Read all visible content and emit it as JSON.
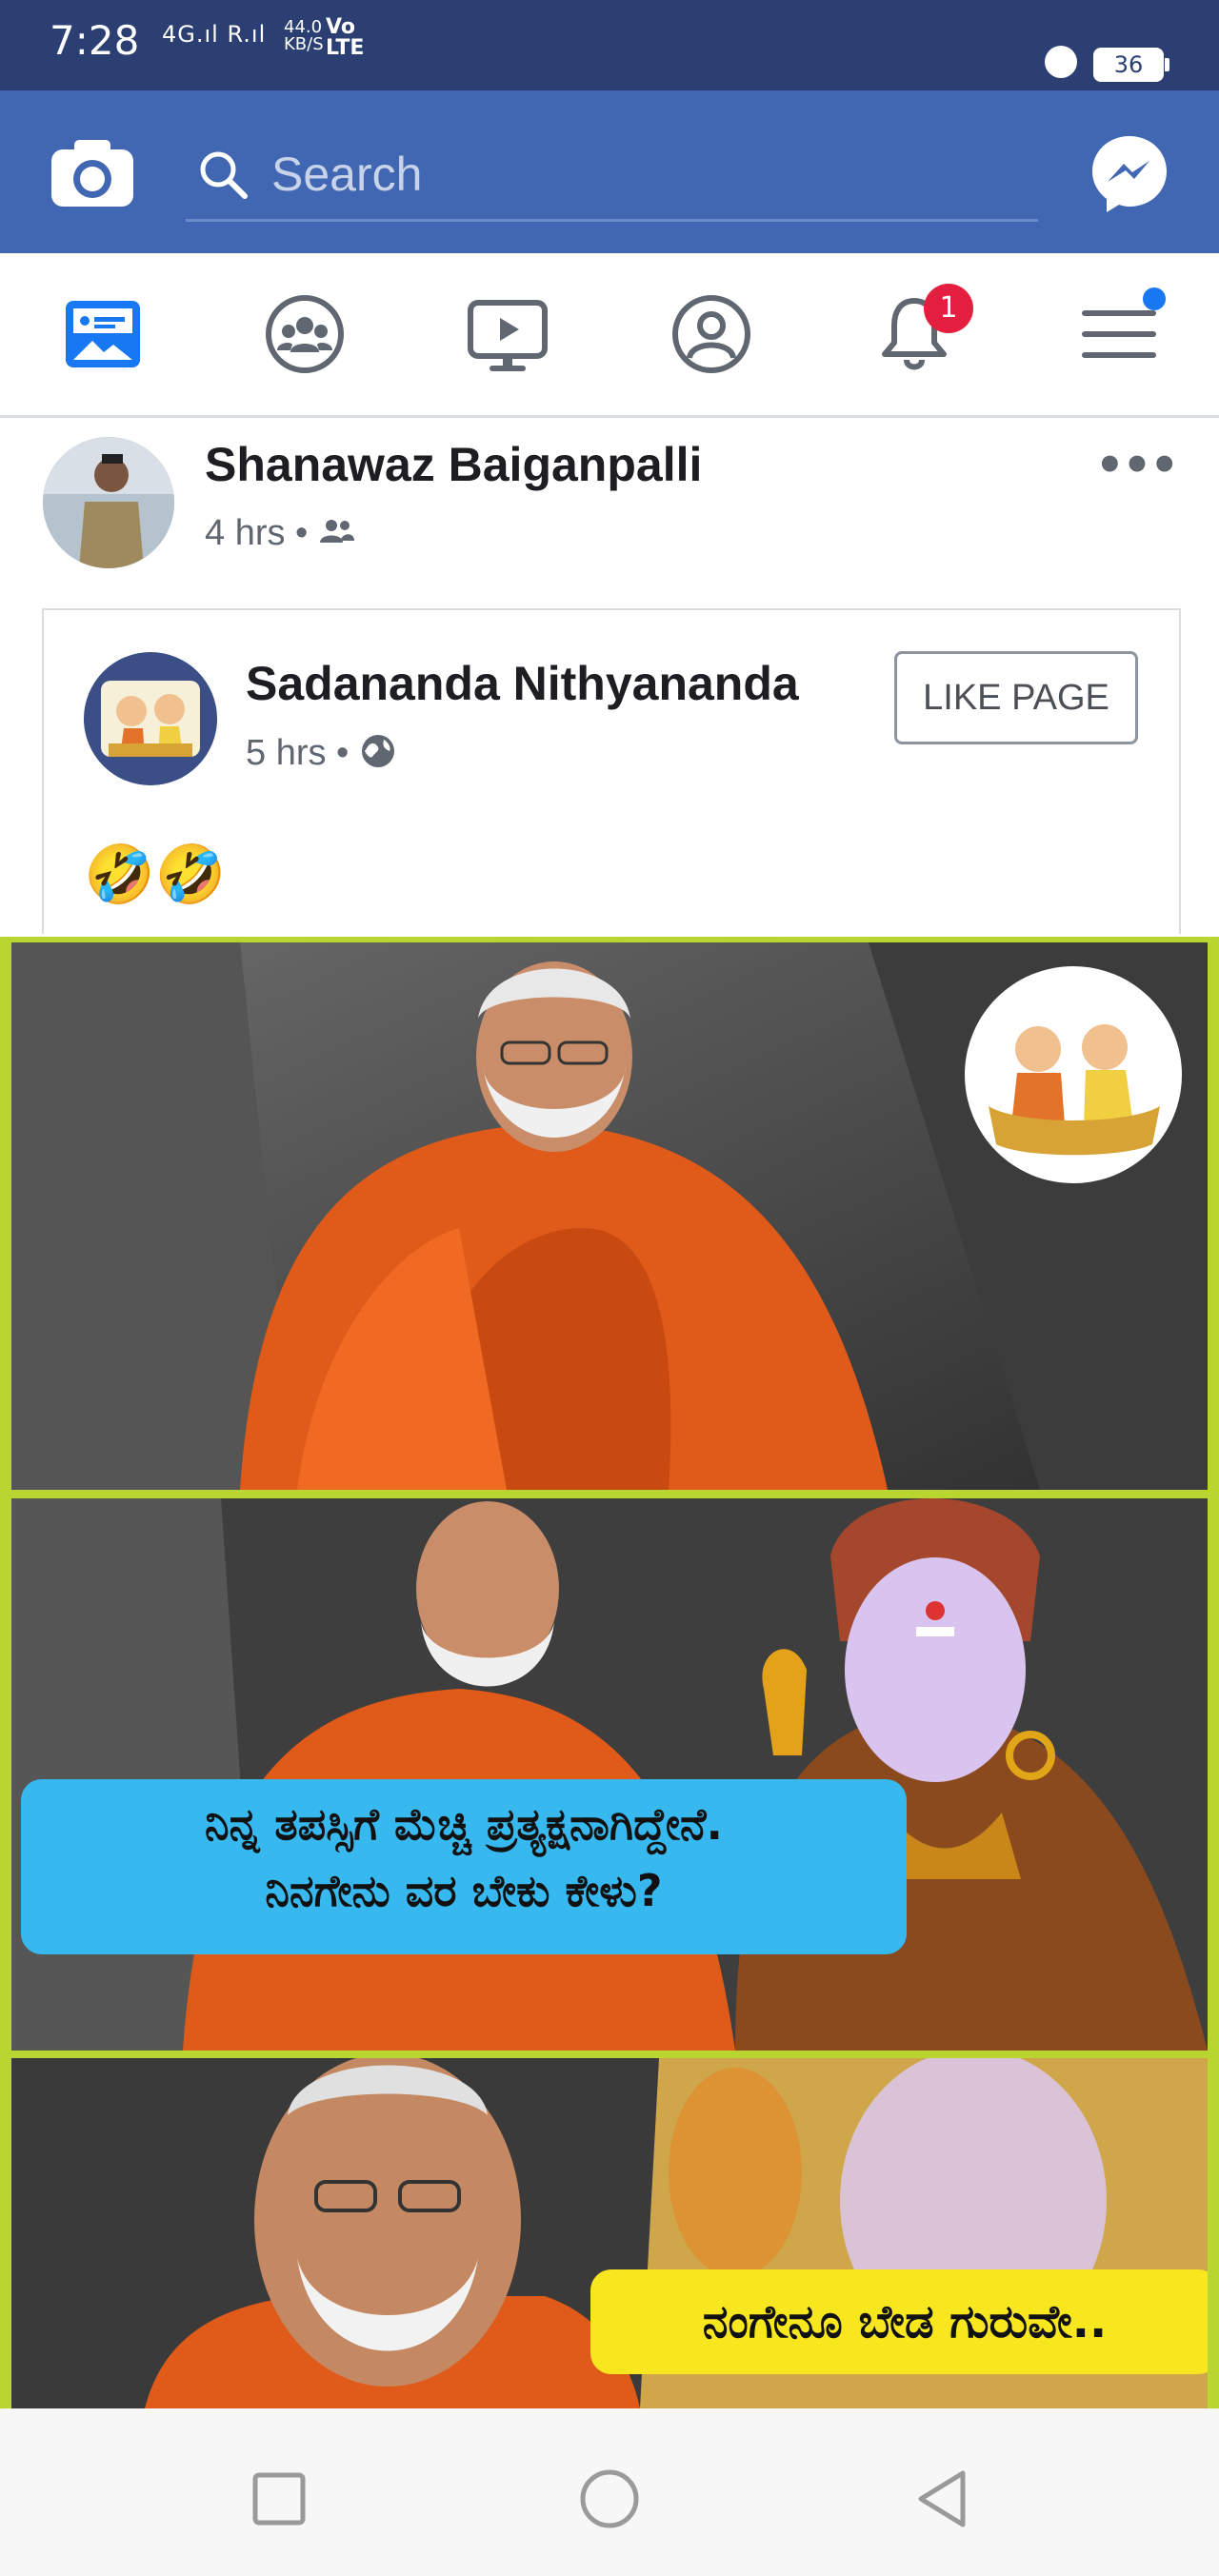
{
  "status_bar": {
    "time": "7:28",
    "signal": "4G.ıl R.ıl",
    "speed_value": "44.0",
    "speed_unit": "KB/S",
    "volte_top": "Vo",
    "volte_bottom": "LTE",
    "battery": "36"
  },
  "header": {
    "search_placeholder": "Search",
    "brand_color": "#4267b2"
  },
  "tabs": [
    {
      "name": "news-feed",
      "icon": "newsfeed-icon",
      "active": true
    },
    {
      "name": "groups",
      "icon": "groups-icon"
    },
    {
      "name": "watch",
      "icon": "watch-icon"
    },
    {
      "name": "profile",
      "icon": "profile-icon"
    },
    {
      "name": "notifications",
      "icon": "bell-icon",
      "badge": "1"
    },
    {
      "name": "menu",
      "icon": "menu-icon",
      "dot": true
    }
  ],
  "post": {
    "author": "Shanawaz Baiganpalli",
    "time": "4 hrs",
    "shared": {
      "page_name": "Sadananda Nithyananda",
      "time": "5 hrs",
      "like_button": "LIKE PAGE",
      "text": "🤣🤣",
      "meme": {
        "caption_1": "ನಿನ್ನ ತಪಸ್ಸಿಗೆ ಮೆಚ್ಚಿ ಪ್ರತ್ಯಕ್ಷನಾಗಿದ್ದೇನೆ.",
        "caption_2": "ನಿನಗೇನು ವರ ಬೇಕು ಕೇಳು?",
        "caption_3": "ನಂಗೇನೂ ಬೇಡ ಗುರುವೇ.."
      }
    }
  }
}
